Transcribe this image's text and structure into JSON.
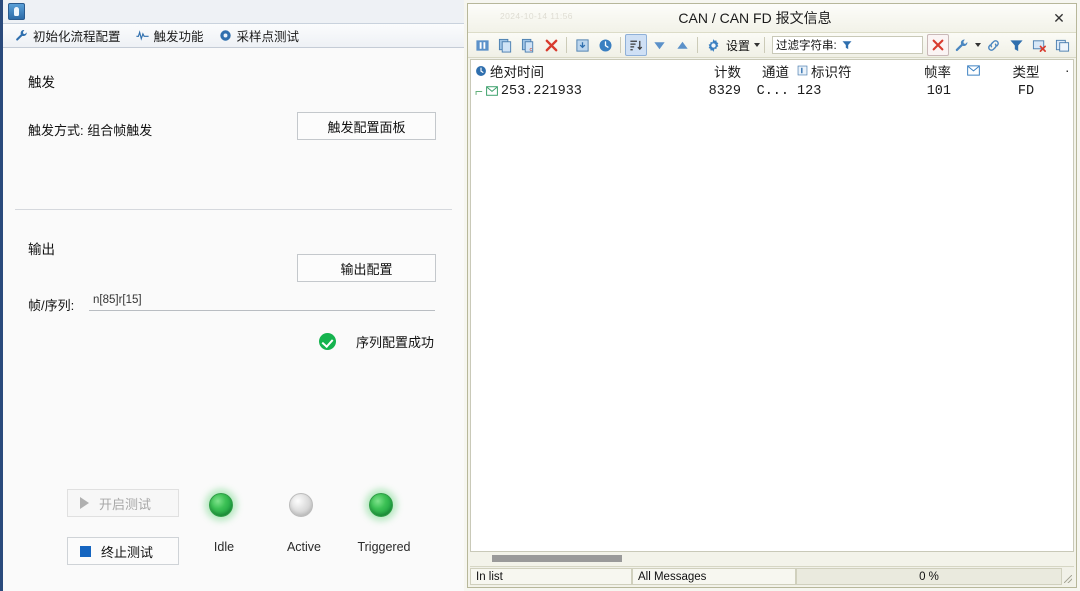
{
  "left_app": {
    "titlebar": {
      "icon": "app-icon"
    },
    "tabs": [
      {
        "label": "初始化流程配置",
        "icon": "wrench-icon"
      },
      {
        "label": "触发功能",
        "icon": "waveform-icon"
      },
      {
        "label": "采样点测试",
        "icon": "blue-circle-icon"
      }
    ],
    "trigger_section": {
      "title": "触发",
      "mode_label": "触发方式: 组合帧触发",
      "config_button": "触发配置面板"
    },
    "output_section": {
      "title": "输出",
      "config_button": "输出配置",
      "frame_seq_label": "帧/序列:",
      "frame_seq_value": "n[85]r[15]",
      "status_text": "序列配置成功",
      "status_color": "#15b34e"
    },
    "controls": {
      "start_button": "开启测试",
      "stop_button": "终止测试",
      "leds": [
        {
          "label": "Idle",
          "state": "on",
          "color": "#3cc155"
        },
        {
          "label": "Active",
          "state": "off",
          "color": "#cfcfcf"
        },
        {
          "label": "Triggered",
          "state": "on",
          "color": "#3cc155"
        }
      ]
    }
  },
  "can_window": {
    "title": "CAN / CAN FD 报文信息",
    "ghost_timestamp": "2024-10-14 11:56",
    "close_label": "✕",
    "toolbar": {
      "pause_icon": "pause-icon",
      "copy_icon": "copy-icon",
      "copy_cell_icon": "copy-cell-icon",
      "clear_icon": "delete-red-x-icon",
      "save_icon": "save-down-icon",
      "time_icon": "clock-icon",
      "sort_icon": "sort-descending-icon",
      "down_icon": "triangle-down-icon",
      "up_icon": "triangle-up-icon",
      "settings_icon": "gear-icon",
      "settings_label": "设置",
      "filter_label": "过滤字符串:",
      "filter_icon": "funnel-icon",
      "filter_value": "",
      "filter_placeholder": "",
      "right_clear_icon": "red-x-icon",
      "right_search_icon": "wrench-search-icon",
      "right_link_icon": "link-icon",
      "right_funnel_icon": "funnel-blue-icon",
      "right_remove_filter_icon": "remove-filter-icon",
      "right_export_icon": "export-window-icon"
    },
    "table": {
      "columns": [
        {
          "key": "time",
          "label": "绝对时间",
          "icon": "clock-blue-icon"
        },
        {
          "key": "count",
          "label": "计数",
          "icon": ""
        },
        {
          "key": "channel",
          "label": "通道",
          "icon": ""
        },
        {
          "key": "identifier",
          "label": "标识符",
          "icon": "id-box-icon"
        },
        {
          "key": "rate",
          "label": "帧率",
          "icon": ""
        },
        {
          "key": "envelope",
          "label": "",
          "icon": "envelope-icon"
        },
        {
          "key": "type",
          "label": "类型",
          "icon": ""
        },
        {
          "key": "more",
          "label": "·",
          "icon": ""
        }
      ],
      "rows": [
        {
          "row_icon": "envelope-green-icon",
          "time": "253.221933",
          "count": "8329",
          "channel": "C...",
          "identifier": "123",
          "rate": "101",
          "envelope": "",
          "type": "FD",
          "more": ""
        }
      ]
    },
    "statusbar": {
      "left": "In list",
      "middle": "All Messages",
      "right": "0 %"
    }
  }
}
